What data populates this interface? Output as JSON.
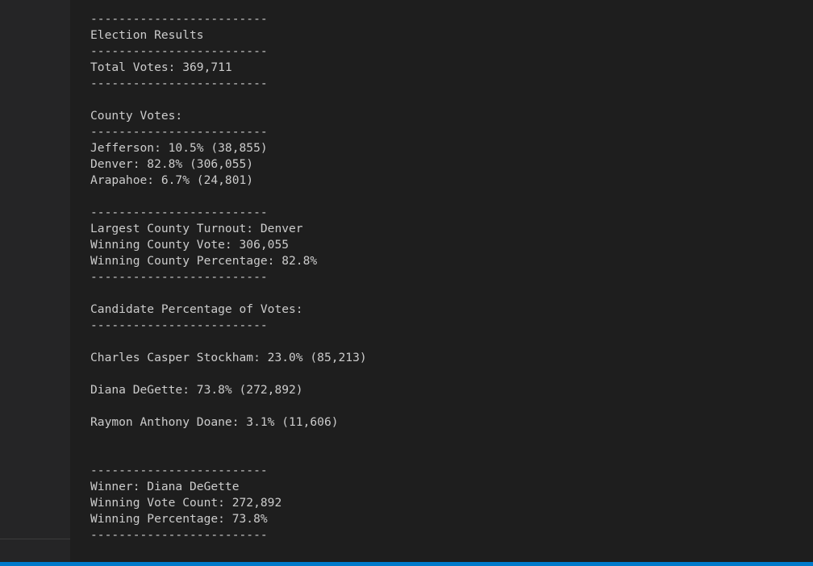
{
  "output": {
    "lines": [
      "-------------------------",
      "Election Results",
      "-------------------------",
      "Total Votes: 369,711",
      "-------------------------",
      "",
      "County Votes:",
      "-------------------------",
      "Jefferson: 10.5% (38,855)",
      "Denver: 82.8% (306,055)",
      "Arapahoe: 6.7% (24,801)",
      "",
      "-------------------------",
      "Largest County Turnout: Denver",
      "Winning County Vote: 306,055",
      "Winning County Percentage: 82.8%",
      "-------------------------",
      "",
      "Candidate Percentage of Votes:",
      "-------------------------",
      "",
      "Charles Casper Stockham: 23.0% (85,213)",
      "",
      "Diana DeGette: 73.8% (272,892)",
      "",
      "Raymon Anthony Doane: 3.1% (11,606)",
      "",
      "",
      "-------------------------",
      "Winner: Diana DeGette",
      "Winning Vote Count: 272,892",
      "Winning Percentage: 73.8%",
      "-------------------------"
    ]
  },
  "colors": {
    "background": "#1e1e1e",
    "sidebar": "#252526",
    "text": "#cccccc",
    "status_bar": "#007acc"
  }
}
